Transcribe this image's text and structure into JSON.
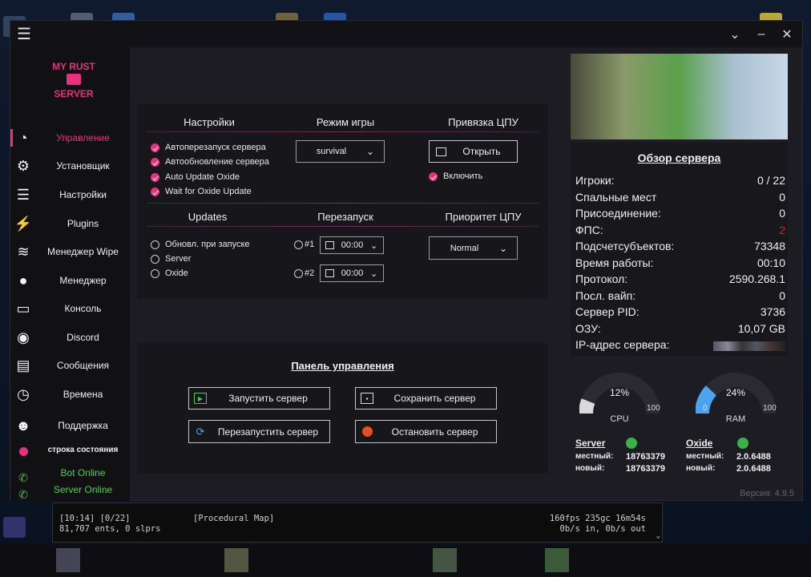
{
  "window": {
    "menu_icon": "hamburger-icon",
    "title_buttons": [
      "chevron-down-icon",
      "minimize-icon",
      "close-icon"
    ]
  },
  "sidebar": {
    "logo_text": "MY RUST SERVER",
    "items": [
      {
        "label": "Управление",
        "icon": "gauge-icon",
        "active": true
      },
      {
        "label": "Установщик",
        "icon": "gear-icon"
      },
      {
        "label": "Настройки",
        "icon": "sliders-icon"
      },
      {
        "label": "Plugins",
        "icon": "plug-icon"
      },
      {
        "label": "Менеджер Wipe",
        "icon": "layers-icon"
      },
      {
        "label": "Менеджер",
        "icon": "user-icon"
      },
      {
        "label": "Консоль",
        "icon": "console-icon"
      },
      {
        "label": "Discord",
        "icon": "discord-icon"
      },
      {
        "label": "Сообщения",
        "icon": "chat-icon"
      },
      {
        "label": "Времена",
        "icon": "clock-icon"
      },
      {
        "label": "Поддержка",
        "icon": "support-icon"
      }
    ],
    "status_label": "строка состояния",
    "bot_status": "Bot Online",
    "server_status": "Server Online"
  },
  "settings": {
    "headers": [
      "Настройки",
      "Режим игры",
      "Привязка ЦПУ"
    ],
    "checks": [
      "Автоперезапуск сервера",
      "Автообновление сервера",
      "Auto Update Oxide",
      "Wait for Oxide Update"
    ],
    "game_mode": "survival",
    "open_button": "Открыть",
    "enable_label": "Включить",
    "headers2": [
      "Updates",
      "Перезапуск",
      "Приоритет ЦПУ"
    ],
    "update_options": [
      "Обновл. при запуске",
      "Server",
      "Oxide"
    ],
    "restart1_label": "#1",
    "restart1_time": "00:00",
    "restart2_label": "#2",
    "restart2_time": "00:00",
    "priority": "Normal"
  },
  "control": {
    "title": "Панель управления",
    "start": "Запустить сервер",
    "save": "Сохранить сервер",
    "restart": "Перезапустить сервер",
    "stop": "Остановить сервер"
  },
  "overview": {
    "title": "Обзор сервера",
    "rows": [
      {
        "k": "Игроки:",
        "v": "0 / 22"
      },
      {
        "k": "Спальные мест",
        "v": "0"
      },
      {
        "k": "Присоединение:",
        "v": "0"
      },
      {
        "k": "ФПС:",
        "v": "2",
        "color": "#e02020"
      },
      {
        "k": "Подсчетсубъектов:",
        "v": "73348"
      },
      {
        "k": "Время работы:",
        "v": "00:10"
      },
      {
        "k": "Протокол:",
        "v": "2590.268.1"
      },
      {
        "k": "Посл. вайп:",
        "v": "0"
      },
      {
        "k": "Сервер PID:",
        "v": "3736"
      },
      {
        "k": "ОЗУ:",
        "v": "10,07 GB"
      },
      {
        "k": "IP-адрес сервера:",
        "v": ""
      }
    ]
  },
  "gauges": {
    "cpu": {
      "value": "12%",
      "pct": 12,
      "label": "CPU",
      "min": "0",
      "max": "100",
      "color": "#d9d9d9"
    },
    "ram": {
      "value": "24%",
      "pct": 24,
      "label": "RAM",
      "min": "0",
      "max": "100",
      "color": "#4da3f0"
    }
  },
  "versions": {
    "server": {
      "name": "Server",
      "local_label": "местный:",
      "local": "18763379",
      "new_label": "новый:",
      "new": "18763379"
    },
    "oxide": {
      "name": "Oxide",
      "local_label": "местный:",
      "local": "2.0.6488",
      "new_label": "новый:",
      "new": "2.0.6488"
    }
  },
  "version_text": "Версия: 4.9.5",
  "terminal": {
    "line1_left": "[10:14] [0/22]",
    "line1_mid": "[Procedural Map]",
    "line1_right": "160fps 235gc 16m54s",
    "line2_left": "81,707 ents, 0 slprs",
    "line2_right": "0b/s in, 0b/s out"
  },
  "accent": "#e8307f"
}
